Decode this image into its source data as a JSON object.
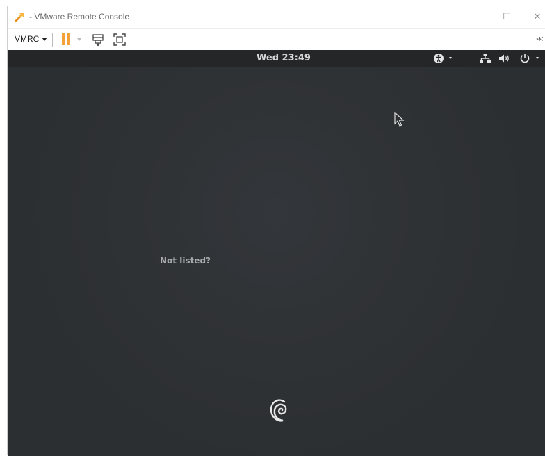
{
  "window": {
    "title": " - VMware Remote Console",
    "min_glyph": "—",
    "max_glyph": "☐",
    "close_glyph": "✕"
  },
  "toolbar": {
    "vmrc_label": "VMRC",
    "more_glyph": "≪",
    "icons": [
      "pause-icon",
      "send-ctrl-alt-del-icon",
      "fit-guest-icon"
    ]
  },
  "guest": {
    "clock": "Wed 23:49",
    "not_listed_label": "Not listed?",
    "indicators": [
      "accessibility-icon",
      "network-icon",
      "volume-icon",
      "power-icon"
    ]
  },
  "colors": {
    "guest_bg": "#2e3133",
    "topbar_bg": "#242628",
    "pause_accent": "#f3a23a"
  }
}
